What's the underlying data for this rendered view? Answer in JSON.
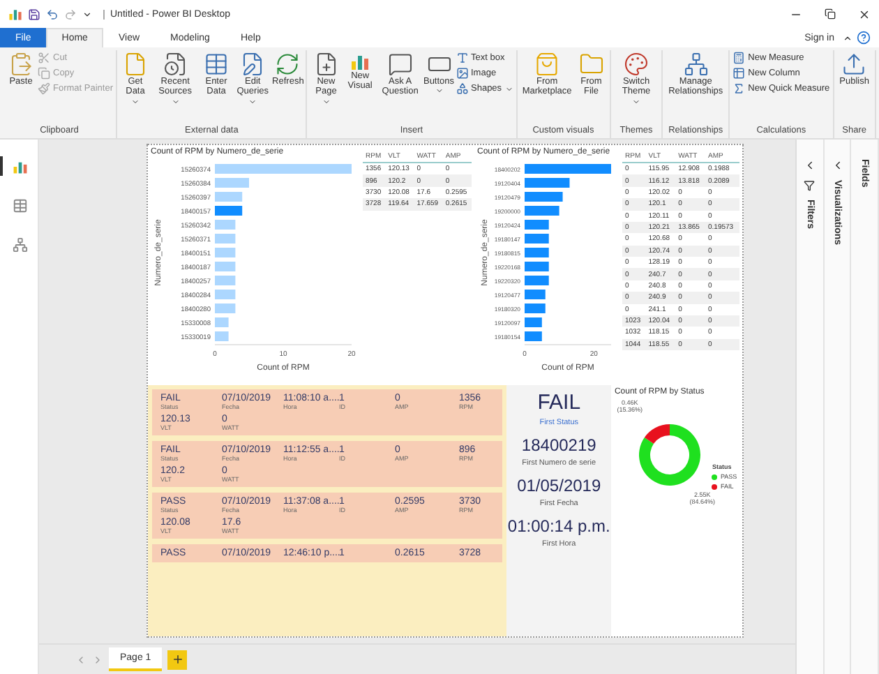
{
  "window": {
    "title": "Untitled - Power BI Desktop",
    "sign_in": "Sign in"
  },
  "tabs": [
    {
      "label": "File",
      "kind": "file",
      "selected": false
    },
    {
      "label": "Home",
      "kind": "tab",
      "selected": true
    },
    {
      "label": "View",
      "kind": "tab",
      "selected": false
    },
    {
      "label": "Modeling",
      "kind": "tab",
      "selected": false
    },
    {
      "label": "Help",
      "kind": "tab",
      "selected": false
    }
  ],
  "ribbon": {
    "groups": [
      {
        "title": "Clipboard",
        "items": [
          {
            "kind": "large",
            "label": "Paste",
            "dropdown": false
          },
          {
            "kind": "stack",
            "items": [
              {
                "label": "Cut",
                "disabled": true
              },
              {
                "label": "Copy",
                "disabled": true
              },
              {
                "label": "Format Painter",
                "disabled": true
              }
            ]
          }
        ]
      },
      {
        "title": "External data",
        "items": [
          {
            "kind": "large",
            "label": "Get Data",
            "dropdown": true
          },
          {
            "kind": "large",
            "label": "Recent Sources",
            "dropdown": true
          },
          {
            "kind": "large",
            "label": "Enter Data",
            "dropdown": false
          },
          {
            "kind": "large",
            "label": "Edit Queries",
            "dropdown": true
          },
          {
            "kind": "large",
            "label": "Refresh",
            "dropdown": false
          }
        ]
      },
      {
        "title": "Insert",
        "items": [
          {
            "kind": "large",
            "label": "New Page",
            "dropdown": true
          },
          {
            "kind": "large",
            "label": "New Visual",
            "dropdown": false
          },
          {
            "kind": "large",
            "label": "Ask A Question",
            "dropdown": false
          },
          {
            "kind": "large",
            "label": "Buttons",
            "dropdown": true
          },
          {
            "kind": "stack",
            "items": [
              {
                "label": "Text box",
                "disabled": false
              },
              {
                "label": "Image",
                "disabled": false
              },
              {
                "label": "Shapes",
                "disabled": false,
                "dropdown": true
              }
            ]
          }
        ]
      },
      {
        "title": "Custom visuals",
        "items": [
          {
            "kind": "large",
            "label": "From Marketplace",
            "dropdown": false
          },
          {
            "kind": "large",
            "label": "From File",
            "dropdown": false
          }
        ]
      },
      {
        "title": "Themes",
        "items": [
          {
            "kind": "large",
            "label": "Switch Theme",
            "dropdown": true
          }
        ]
      },
      {
        "title": "Relationships",
        "items": [
          {
            "kind": "large",
            "label": "Manage Relationships",
            "dropdown": false
          }
        ]
      },
      {
        "title": "Calculations",
        "items": [
          {
            "kind": "stack",
            "items": [
              {
                "label": "New Measure",
                "disabled": false
              },
              {
                "label": "New Column",
                "disabled": false
              },
              {
                "label": "New Quick Measure",
                "disabled": false
              }
            ]
          }
        ]
      },
      {
        "title": "Share",
        "items": [
          {
            "kind": "large",
            "label": "Publish",
            "dropdown": false
          }
        ]
      }
    ]
  },
  "views": [
    {
      "kind": "report",
      "selected": true
    },
    {
      "kind": "data",
      "selected": false
    },
    {
      "kind": "model",
      "selected": false
    }
  ],
  "panes": [
    {
      "label": "Filters"
    },
    {
      "label": "Visualizations"
    },
    {
      "label": "Fields"
    }
  ],
  "report": {
    "bar_charts": [
      {
        "bar_selected": [
          false,
          false,
          false,
          true,
          false,
          false,
          false,
          false,
          false,
          false,
          false,
          false,
          false
        ],
        "chart_data": {
          "type": "bar",
          "orientation": "horizontal",
          "title": "Count of RPM by Numero_de_serie",
          "xlabel": "Count of RPM",
          "ylabel": "Numero_de_serie",
          "categories": [
            "15260374",
            "15260384",
            "15260397",
            "18400157",
            "15260342",
            "15260371",
            "18400151",
            "18400187",
            "18400257",
            "18400284",
            "18400280",
            "15330008",
            "15330019"
          ],
          "series": [
            {
              "color": "#118dff",
              "values": [
                20,
                5,
                4,
                4,
                3,
                3,
                3,
                3,
                3,
                3,
                3,
                2,
                2
              ]
            }
          ],
          "xlim": [
            0,
            20
          ],
          "xticks": [
            0,
            10,
            20
          ]
        }
      },
      {
        "chart_data": {
          "type": "bar",
          "orientation": "horizontal",
          "title": "Count of RPM by Numero_de_serie",
          "xlabel": "Count of RPM",
          "ylabel": "Numero_de_serie",
          "categories": [
            "18400202",
            "19120404",
            "19120479",
            "19200000",
            "19120424",
            "19180147",
            "19180815",
            "19220168",
            "19220320",
            "19120477",
            "19180320",
            "19120097",
            "19180154"
          ],
          "series": [
            {
              "color": "#118dff",
              "values": [
                25,
                13,
                11,
                10,
                7,
                7,
                7,
                7,
                7,
                6,
                6,
                5,
                5
              ]
            }
          ],
          "xlim": [
            0,
            25
          ],
          "xticks": [
            0,
            20
          ]
        }
      }
    ],
    "tables": [
      {
        "columns": [
          "RPM",
          "VLT",
          "WATT",
          "AMP"
        ],
        "rows": [
          [
            "1356",
            "120.13",
            "0",
            "0"
          ],
          [
            "896",
            "120.2",
            "0",
            "0"
          ],
          [
            "3730",
            "120.08",
            "17.6",
            "0.2595"
          ],
          [
            "3728",
            "119.64",
            "17.659",
            "0.2615"
          ]
        ]
      },
      {
        "columns": [
          "RPM",
          "VLT",
          "WATT",
          "AMP"
        ],
        "rows": [
          [
            "0",
            "115.95",
            "12.908",
            "0.1988"
          ],
          [
            "0",
            "116.12",
            "13.818",
            "0.2089"
          ],
          [
            "0",
            "120.02",
            "0",
            "0"
          ],
          [
            "0",
            "120.1",
            "0",
            "0"
          ],
          [
            "0",
            "120.11",
            "0",
            "0"
          ],
          [
            "0",
            "120.21",
            "13.865",
            "0.19573"
          ],
          [
            "0",
            "120.68",
            "0",
            "0"
          ],
          [
            "0",
            "120.74",
            "0",
            "0"
          ],
          [
            "0",
            "128.19",
            "0",
            "0"
          ],
          [
            "0",
            "240.7",
            "0",
            "0"
          ],
          [
            "0",
            "240.8",
            "0",
            "0"
          ],
          [
            "0",
            "240.9",
            "0",
            "0"
          ],
          [
            "0",
            "241.1",
            "0",
            "0"
          ],
          [
            "1023",
            "120.04",
            "0",
            "0"
          ],
          [
            "1032",
            "118.15",
            "0",
            "0"
          ],
          [
            "1044",
            "118.55",
            "0",
            "0"
          ]
        ]
      }
    ],
    "records": [
      {
        "fields": [
          {
            "value": "FAIL",
            "label": "Status"
          },
          {
            "value": "07/10/2019",
            "label": "Fecha"
          },
          {
            "value": "11:08:10 a....",
            "label": "Hora"
          },
          {
            "value": "1",
            "label": "ID"
          },
          {
            "value": "0",
            "label": "AMP"
          },
          {
            "value": "1356",
            "label": "RPM"
          },
          {
            "value": "120.13",
            "label": "VLT"
          },
          {
            "value": "0",
            "label": "WATT"
          }
        ]
      },
      {
        "fields": [
          {
            "value": "FAIL",
            "label": "Status"
          },
          {
            "value": "07/10/2019",
            "label": "Fecha"
          },
          {
            "value": "11:12:55 a....",
            "label": "Hora"
          },
          {
            "value": "1",
            "label": "ID"
          },
          {
            "value": "0",
            "label": "AMP"
          },
          {
            "value": "896",
            "label": "RPM"
          },
          {
            "value": "120.2",
            "label": "VLT"
          },
          {
            "value": "0",
            "label": "WATT"
          }
        ]
      },
      {
        "fields": [
          {
            "value": "PASS",
            "label": "Status"
          },
          {
            "value": "07/10/2019",
            "label": "Fecha"
          },
          {
            "value": "11:37:08 a....",
            "label": "Hora"
          },
          {
            "value": "1",
            "label": "ID"
          },
          {
            "value": "0.2595",
            "label": "AMP"
          },
          {
            "value": "3730",
            "label": "RPM"
          },
          {
            "value": "120.08",
            "label": "VLT"
          },
          {
            "value": "17.6",
            "label": "WATT"
          }
        ]
      },
      {
        "fields": [
          {
            "value": "PASS"
          },
          {
            "value": "07/10/2019"
          },
          {
            "value": "12:46:10 p...."
          },
          {
            "value": "1"
          },
          {
            "value": "0.2615"
          },
          {
            "value": "3728"
          }
        ]
      }
    ],
    "cards": [
      {
        "value": "FAIL",
        "label": "First Status"
      },
      {
        "value": "18400219",
        "label": "First Numero de serie"
      },
      {
        "value": "01/05/2019",
        "label": "First Fecha"
      },
      {
        "value": "01:00:14 p.m.",
        "label": "First Hora"
      }
    ],
    "donut": {
      "legend_title": "Status",
      "legend": [
        {
          "color": "#1fe01f"
        },
        {
          "color": "#e8111e"
        }
      ],
      "chart_data": {
        "type": "donut",
        "title": "Count of RPM by Status",
        "categories": [
          "PASS",
          "FAIL"
        ],
        "series": [
          {
            "values": [
              84.64,
              15.36
            ]
          }
        ],
        "value_labels": [
          "2.55K (84.64%)",
          "0.46K (15.36%)"
        ]
      }
    }
  },
  "pages": [
    {
      "label": "Page 1",
      "selected": true
    }
  ]
}
